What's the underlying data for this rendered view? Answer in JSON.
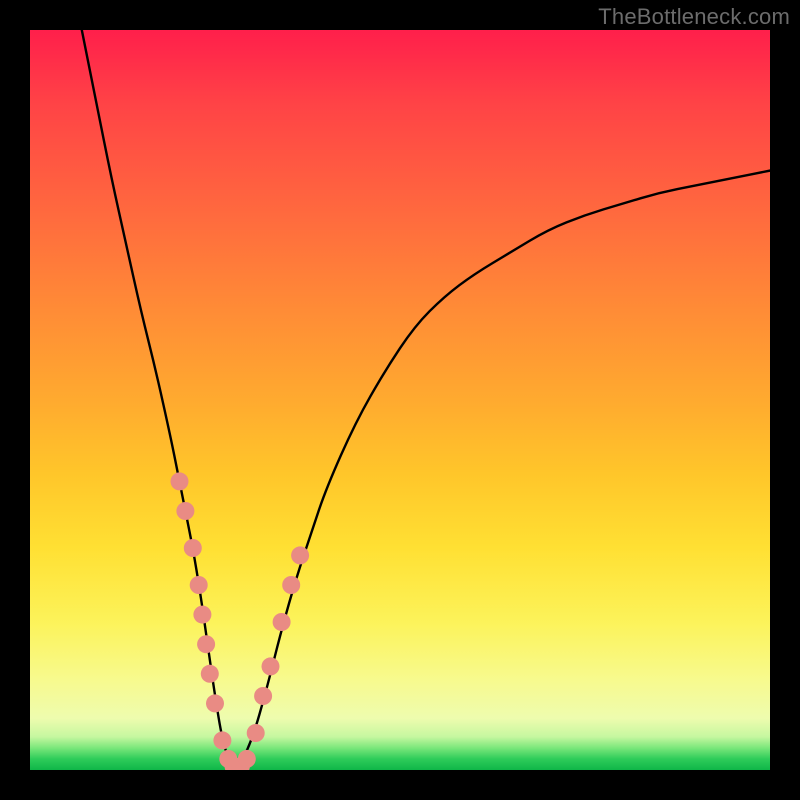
{
  "watermark": "TheBottleneck.com",
  "chart_data": {
    "type": "line",
    "title": "",
    "xlabel": "",
    "ylabel": "",
    "xlim": [
      0,
      100
    ],
    "ylim": [
      0,
      100
    ],
    "grid": false,
    "legend": false,
    "annotations": [],
    "series": [
      {
        "name": "curve",
        "style": "line",
        "color": "#000000",
        "x": [
          7,
          9,
          11,
          13,
          15,
          17,
          19,
          20,
          21,
          22,
          23,
          24,
          25,
          26,
          27,
          28,
          30,
          32,
          34,
          36,
          38,
          40,
          44,
          48,
          52,
          56,
          60,
          65,
          70,
          75,
          80,
          85,
          90,
          95,
          100
        ],
        "y": [
          100,
          90,
          80,
          71,
          62,
          54,
          45,
          40,
          35,
          30,
          24,
          17,
          10,
          4,
          1,
          0,
          4,
          11,
          19,
          26,
          32,
          38,
          47,
          54,
          60,
          64,
          67,
          70,
          73,
          75,
          76.5,
          78,
          79,
          80,
          81
        ]
      },
      {
        "name": "highlight-dots",
        "style": "scatter",
        "color": "#e98b84",
        "x": [
          20.2,
          21.0,
          22.0,
          22.8,
          23.3,
          23.8,
          24.3,
          25.0,
          26.0,
          26.8,
          27.5,
          28.5,
          29.3,
          30.5,
          31.5,
          32.5,
          34.0,
          35.3,
          36.5
        ],
        "y": [
          39,
          35,
          30,
          25,
          21,
          17,
          13,
          9,
          4,
          1.5,
          0.5,
          0.5,
          1.5,
          5,
          10,
          14,
          20,
          25,
          29
        ]
      }
    ]
  }
}
